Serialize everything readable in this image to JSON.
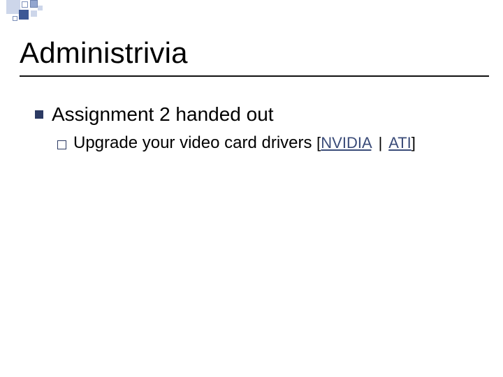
{
  "title": "Administrivia",
  "bullets": {
    "lvl1_text": "Assignment 2 handed out",
    "lvl2_prefix": "Upgrade your video card drivers",
    "links_open": "[",
    "links_close": "]",
    "link_nvidia": "NVIDIA",
    "link_sep": "|",
    "link_ati": "ATI"
  }
}
